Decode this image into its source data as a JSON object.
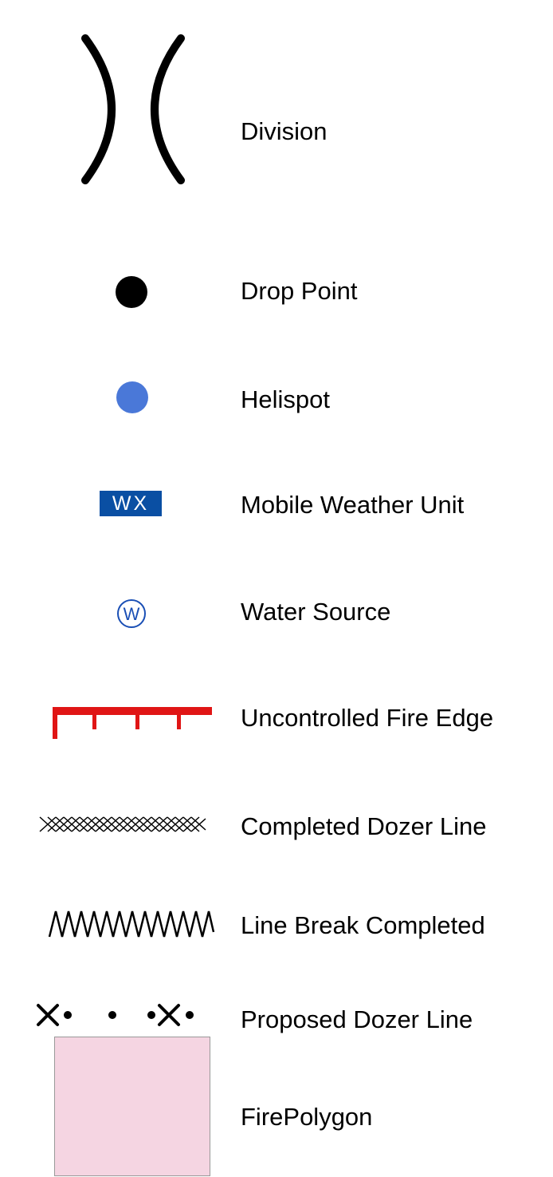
{
  "legend": {
    "items": [
      {
        "symbol": "division-icon",
        "label": "Division"
      },
      {
        "symbol": "drop-point-icon",
        "label": "Drop Point"
      },
      {
        "symbol": "helispot-icon",
        "label": "Helispot"
      },
      {
        "symbol": "mobile-weather-unit-icon",
        "label": "Mobile Weather Unit",
        "symbol_text": "WX"
      },
      {
        "symbol": "water-source-icon",
        "label": "Water Source",
        "symbol_text": "W"
      },
      {
        "symbol": "uncontrolled-fire-edge-icon",
        "label": "Uncontrolled Fire Edge"
      },
      {
        "symbol": "completed-dozer-line-icon",
        "label": "Completed Dozer Line"
      },
      {
        "symbol": "line-break-completed-icon",
        "label": "Line Break Completed"
      },
      {
        "symbol": "proposed-dozer-line-icon",
        "label": "Proposed Dozer Line"
      },
      {
        "symbol": "fire-polygon-swatch",
        "label": "FirePolygon"
      }
    ]
  },
  "colors": {
    "helispot": "#4a78d8",
    "mobile_weather_unit": "#0a4fa3",
    "water_source": "#1a4fb5",
    "uncontrolled_fire_edge": "#e01515",
    "fire_polygon": "#f5d5e2",
    "text": "#000000",
    "background": "#ffffff"
  }
}
